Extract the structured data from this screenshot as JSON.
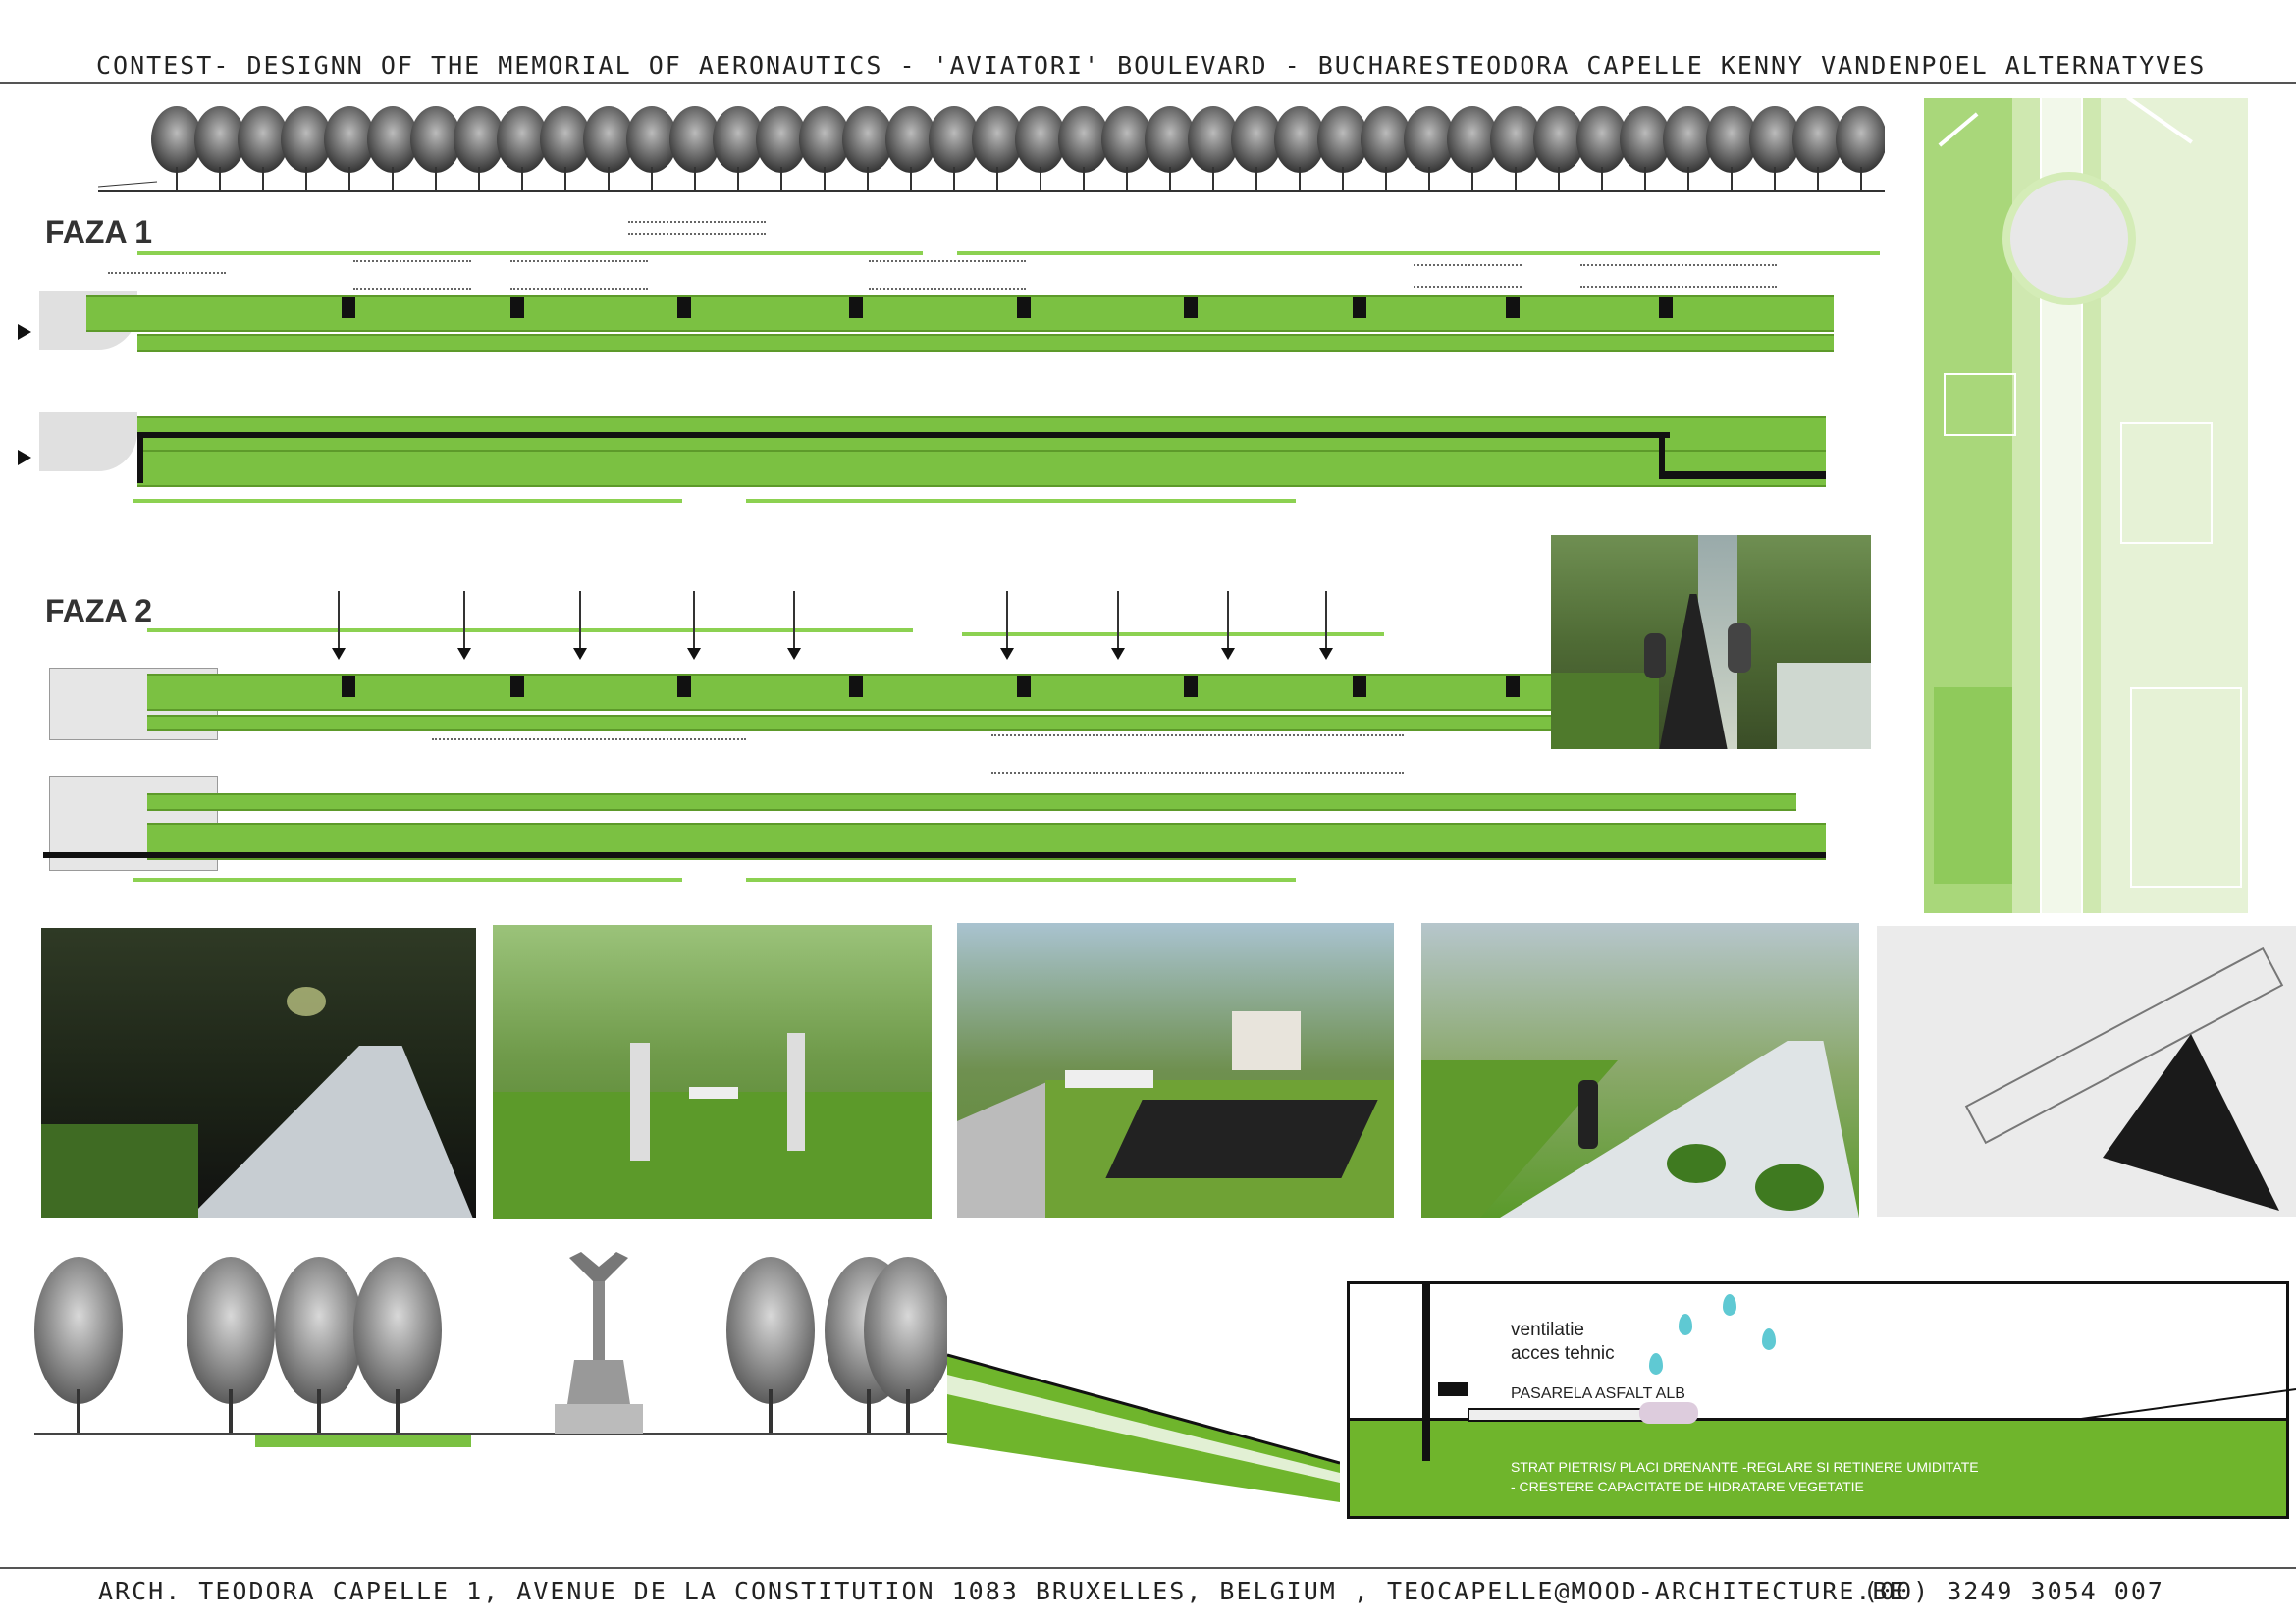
{
  "header": {
    "title": "CONTEST-  DESIGNN OF THE MEMORIAL OF AERONAUTICS - 'AVIATORI' BOULEVARD - BUCHAREST",
    "authors": "TEODORA CAPELLE   KENNY VANDENPOEL ALTERNATYVES"
  },
  "phases": {
    "faza1": "FAZA 1",
    "faza2": "FAZA 2"
  },
  "section_detail": {
    "label1": "ventilatie",
    "label2": "acces tehnic",
    "label3": "PASARELA ASFALT ALB",
    "label4": "STRAT PIETRIS/ PLACI DRENANTE -REGLARE SI RETINERE UMIDITATE",
    "label5": "- CRESTERE CAPACITATE DE HIDRATARE VEGETATIE"
  },
  "footer": {
    "address": "ARCH. TEODORA CAPELLE   1, AVENUE DE LA CONSTITUTION 1083 BRUXELLES, BELGIUM  , TEOCAPELLE@MOOD-ARCHITECTURE.BE",
    "phone": "(00)    3249    3054    007"
  },
  "colors": {
    "accent_green": "#7bc142",
    "light_green": "#cfe8b0",
    "dark": "#111111"
  }
}
